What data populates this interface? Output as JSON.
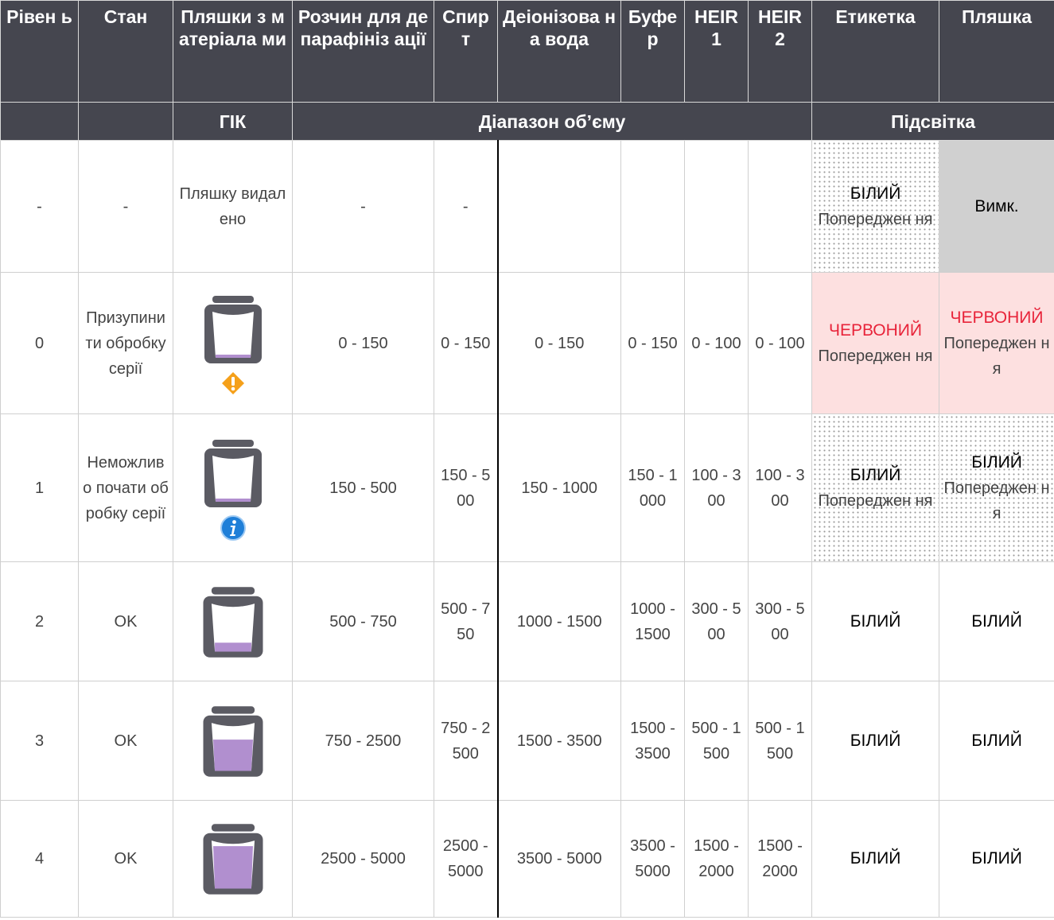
{
  "header": {
    "cols": [
      "Рівен ь",
      "Стан",
      "Пляшки з матеріала ми",
      "Розчин для депарафініз ації",
      "Спир т",
      "Деіонізова на вода",
      "Буфе р",
      "HEIR 1",
      "HEIR 2",
      "Етикетка",
      "Пляшка"
    ],
    "sub": {
      "gik": "ГІК",
      "range": "Діапазон об’єму",
      "light": "Підсвітка"
    }
  },
  "rows": [
    {
      "level": "-",
      "state": "-",
      "bottle_text": "Пляшку видалено",
      "depar": "-",
      "spirit": "-",
      "water": "",
      "buffer": "",
      "heir1": "",
      "heir2": "",
      "label_color": "БІЛИЙ",
      "label_note": "Попереджен ня",
      "bottle_light": "Вимк.",
      "bottle_note": ""
    },
    {
      "level": "0",
      "state": "Призупини ти обробку серії",
      "depar": "0 - 150",
      "spirit": "0 - 150",
      "water": "0 - 150",
      "buffer": "0 - 150",
      "heir1": "0 - 100",
      "heir2": "0 - 100",
      "label_color": "ЧЕРВОНИЙ",
      "label_note": "Попереджен ня",
      "bottle_light": "ЧЕРВОНИЙ",
      "bottle_note": "Попереджен ня"
    },
    {
      "level": "1",
      "state": "Неможлив о почати обробку серії",
      "depar": "150 - 500",
      "spirit": "150 - 500",
      "water": "150 - 1000",
      "buffer": "150 - 1000",
      "heir1": "100 - 300",
      "heir2": "100 - 300",
      "label_color": "БІЛИЙ",
      "label_note": "Попереджен ня",
      "bottle_light": "БІЛИЙ",
      "bottle_note": "Попереджен ня"
    },
    {
      "level": "2",
      "state": "OK",
      "depar": "500 - 750",
      "spirit": "500 - 750",
      "water": "1000 - 1500",
      "buffer": "1000 - 1500",
      "heir1": "300 - 500",
      "heir2": "300 - 500",
      "label_color": "БІЛИЙ",
      "bottle_light": "БІЛИЙ"
    },
    {
      "level": "3",
      "state": "OK",
      "depar": "750 - 2500",
      "spirit": "750 - 2500",
      "water": "1500 - 3500",
      "buffer": "1500 - 3500",
      "heir1": "500 - 1500",
      "heir2": "500 - 1500",
      "label_color": "БІЛИЙ",
      "bottle_light": "БІЛИЙ"
    },
    {
      "level": "4",
      "state": "OK",
      "depar": "2500 - 5000",
      "spirit": "2500 - 5000",
      "water": "3500 - 5000",
      "buffer": "3500 - 5000",
      "heir1": "1500 - 2000",
      "heir2": "1500 - 2000",
      "label_color": "БІЛИЙ",
      "bottle_light": "БІЛИЙ"
    }
  ],
  "colors": {
    "header_bg": "#45464f",
    "red_text": "#e8243a",
    "pale_red": "#fde0e0",
    "grey_cell": "#d0d0d0",
    "fill_purple": "#b18fcf",
    "bottle_gray": "#5b5b63",
    "warning_orange": "#f5a01a",
    "info_blue": "#1f7fd8"
  },
  "icons": {
    "row0": "none",
    "row1": "warning-diamond-icon",
    "row2": "info-circle-icon"
  },
  "fill_levels": [
    0.0,
    0.04,
    0.06,
    0.2,
    0.7,
    0.95
  ]
}
